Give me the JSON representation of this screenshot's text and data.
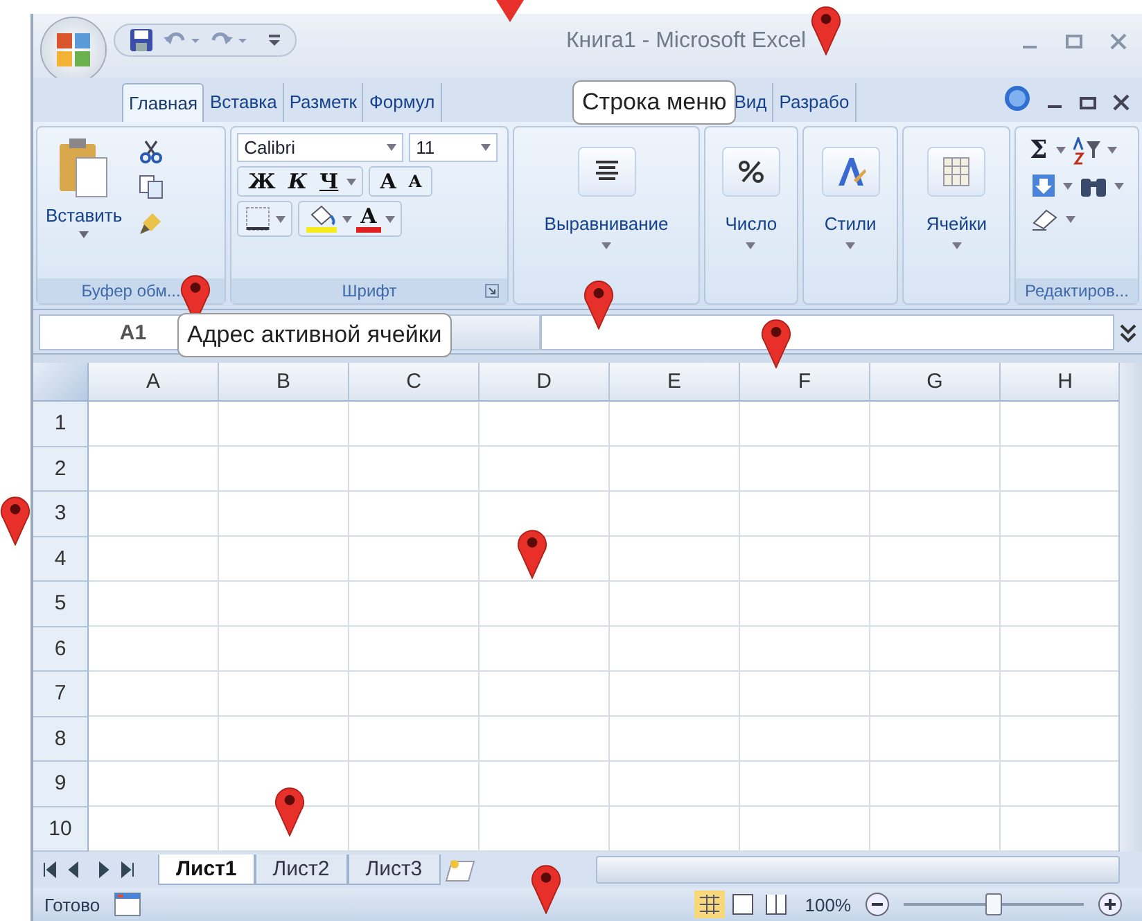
{
  "window": {
    "title": "Книга1 - Microsoft Excel"
  },
  "tabs": [
    {
      "label": "Главная",
      "selected": true
    },
    {
      "label": "Вставка",
      "selected": false
    },
    {
      "label": "Разметк",
      "selected": false
    },
    {
      "label": "Формул",
      "selected": false
    },
    {
      "label": "Вид",
      "selected": false
    },
    {
      "label": "Разрабо",
      "selected": false
    }
  ],
  "ribbon": {
    "clipboard": {
      "paste": "Вставить",
      "label": "Буфер обм..."
    },
    "font": {
      "name": "Calibri",
      "size": "11",
      "bold": "Ж",
      "italic": "К",
      "underline": "Ч",
      "grow": "A",
      "shrink": "A",
      "text_color_letter": "A",
      "label": "Шрифт"
    },
    "groups": [
      {
        "label": "Выравнивание",
        "kind": "align"
      },
      {
        "label": "Число",
        "kind": "number"
      },
      {
        "label": "Стили",
        "kind": "styles"
      },
      {
        "label": "Ячейки",
        "kind": "cells"
      }
    ],
    "editing": {
      "sum": "Σ",
      "label": "Редактиров..."
    }
  },
  "name_box": {
    "value": "A1"
  },
  "columns": [
    "A",
    "B",
    "C",
    "D",
    "E",
    "F",
    "G",
    "H"
  ],
  "rows": [
    "1",
    "2",
    "3",
    "4",
    "5",
    "6",
    "7",
    "8",
    "9",
    "10"
  ],
  "sheets": [
    {
      "label": "Лист1",
      "selected": true
    },
    {
      "label": "Лист2",
      "selected": false
    },
    {
      "label": "Лист3",
      "selected": false
    }
  ],
  "status_bar": {
    "text": "Готово",
    "zoom": "100%"
  },
  "zoom_slider": {
    "level": 0.5
  },
  "callouts": [
    {
      "text": "Строка меню"
    },
    {
      "text": "Адрес активной ячейки"
    }
  ]
}
